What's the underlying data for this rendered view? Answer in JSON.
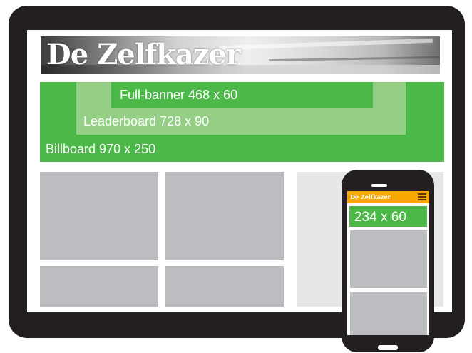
{
  "masthead": {
    "logo_text": "De Zelfkazer"
  },
  "ad_formats": {
    "full_banner": "Full-banner 468 x 60",
    "leaderboard": "Leaderboard 728 x 90",
    "billboard": "Billboard 970 x 250"
  },
  "mobile": {
    "logo_text": "De Zelfkazer",
    "banner": "234 x 60",
    "header_color": "#f6a800"
  },
  "colors": {
    "device": "#231f20",
    "ad_green": "#4cb848",
    "ad_light_green": "#94cf85",
    "content_grey": "#bcbdc0",
    "sidebar_grey": "#e6e7e8"
  },
  "icons": {
    "mobile_menu": "hamburger-menu-icon"
  }
}
